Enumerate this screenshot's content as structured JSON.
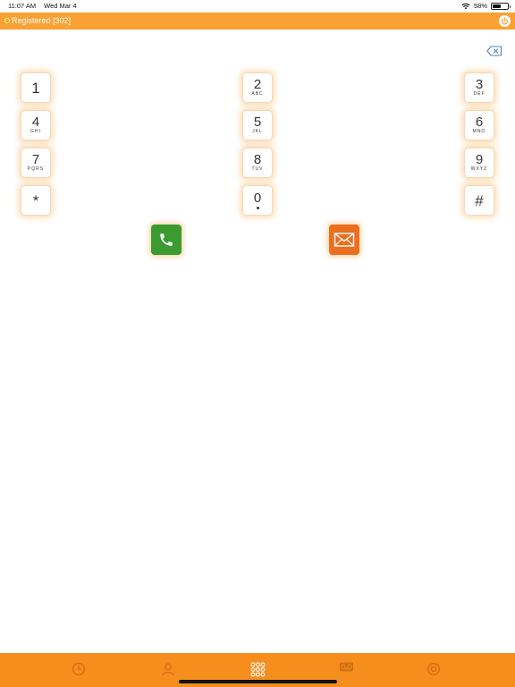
{
  "status_bar": {
    "time": "11:07 AM",
    "date": "Wed Mar 4",
    "battery": "58%",
    "battery_level": 0.58,
    "icons": [
      "wifi-icon",
      "battery-icon"
    ]
  },
  "header": {
    "registration": "Registered [302]",
    "status_color": "#f3ff9a",
    "background": "#f9a133",
    "icons": [
      "registration-status-icon",
      "power-icon"
    ]
  },
  "dialpad": {
    "keys": [
      {
        "digit": "1",
        "letters": ""
      },
      {
        "digit": "2",
        "letters": "ABC"
      },
      {
        "digit": "3",
        "letters": "DEF"
      },
      {
        "digit": "4",
        "letters": "GHI"
      },
      {
        "digit": "5",
        "letters": "JKL"
      },
      {
        "digit": "6",
        "letters": "MNO"
      },
      {
        "digit": "7",
        "letters": "PQRS"
      },
      {
        "digit": "8",
        "letters": "TUV"
      },
      {
        "digit": "9",
        "letters": "WXYZ"
      },
      {
        "digit": "*",
        "letters": ""
      },
      {
        "digit": "0",
        "letters": ""
      },
      {
        "digit": "#",
        "letters": ""
      }
    ],
    "icons": [
      "backspace-icon",
      "phone-icon",
      "envelope-icon"
    ],
    "call_color": "#3b9b31",
    "message_color": "#ec6e1f"
  },
  "tab_bar": {
    "background": "#f58e1d",
    "tabs": [
      {
        "icon": "recents-clock-icon",
        "active": false
      },
      {
        "icon": "contacts-person-icon",
        "active": false
      },
      {
        "icon": "keypad-grid-icon",
        "active": true
      },
      {
        "icon": "voicemail-icon",
        "active": false
      },
      {
        "icon": "settings-icon",
        "active": false
      }
    ]
  }
}
